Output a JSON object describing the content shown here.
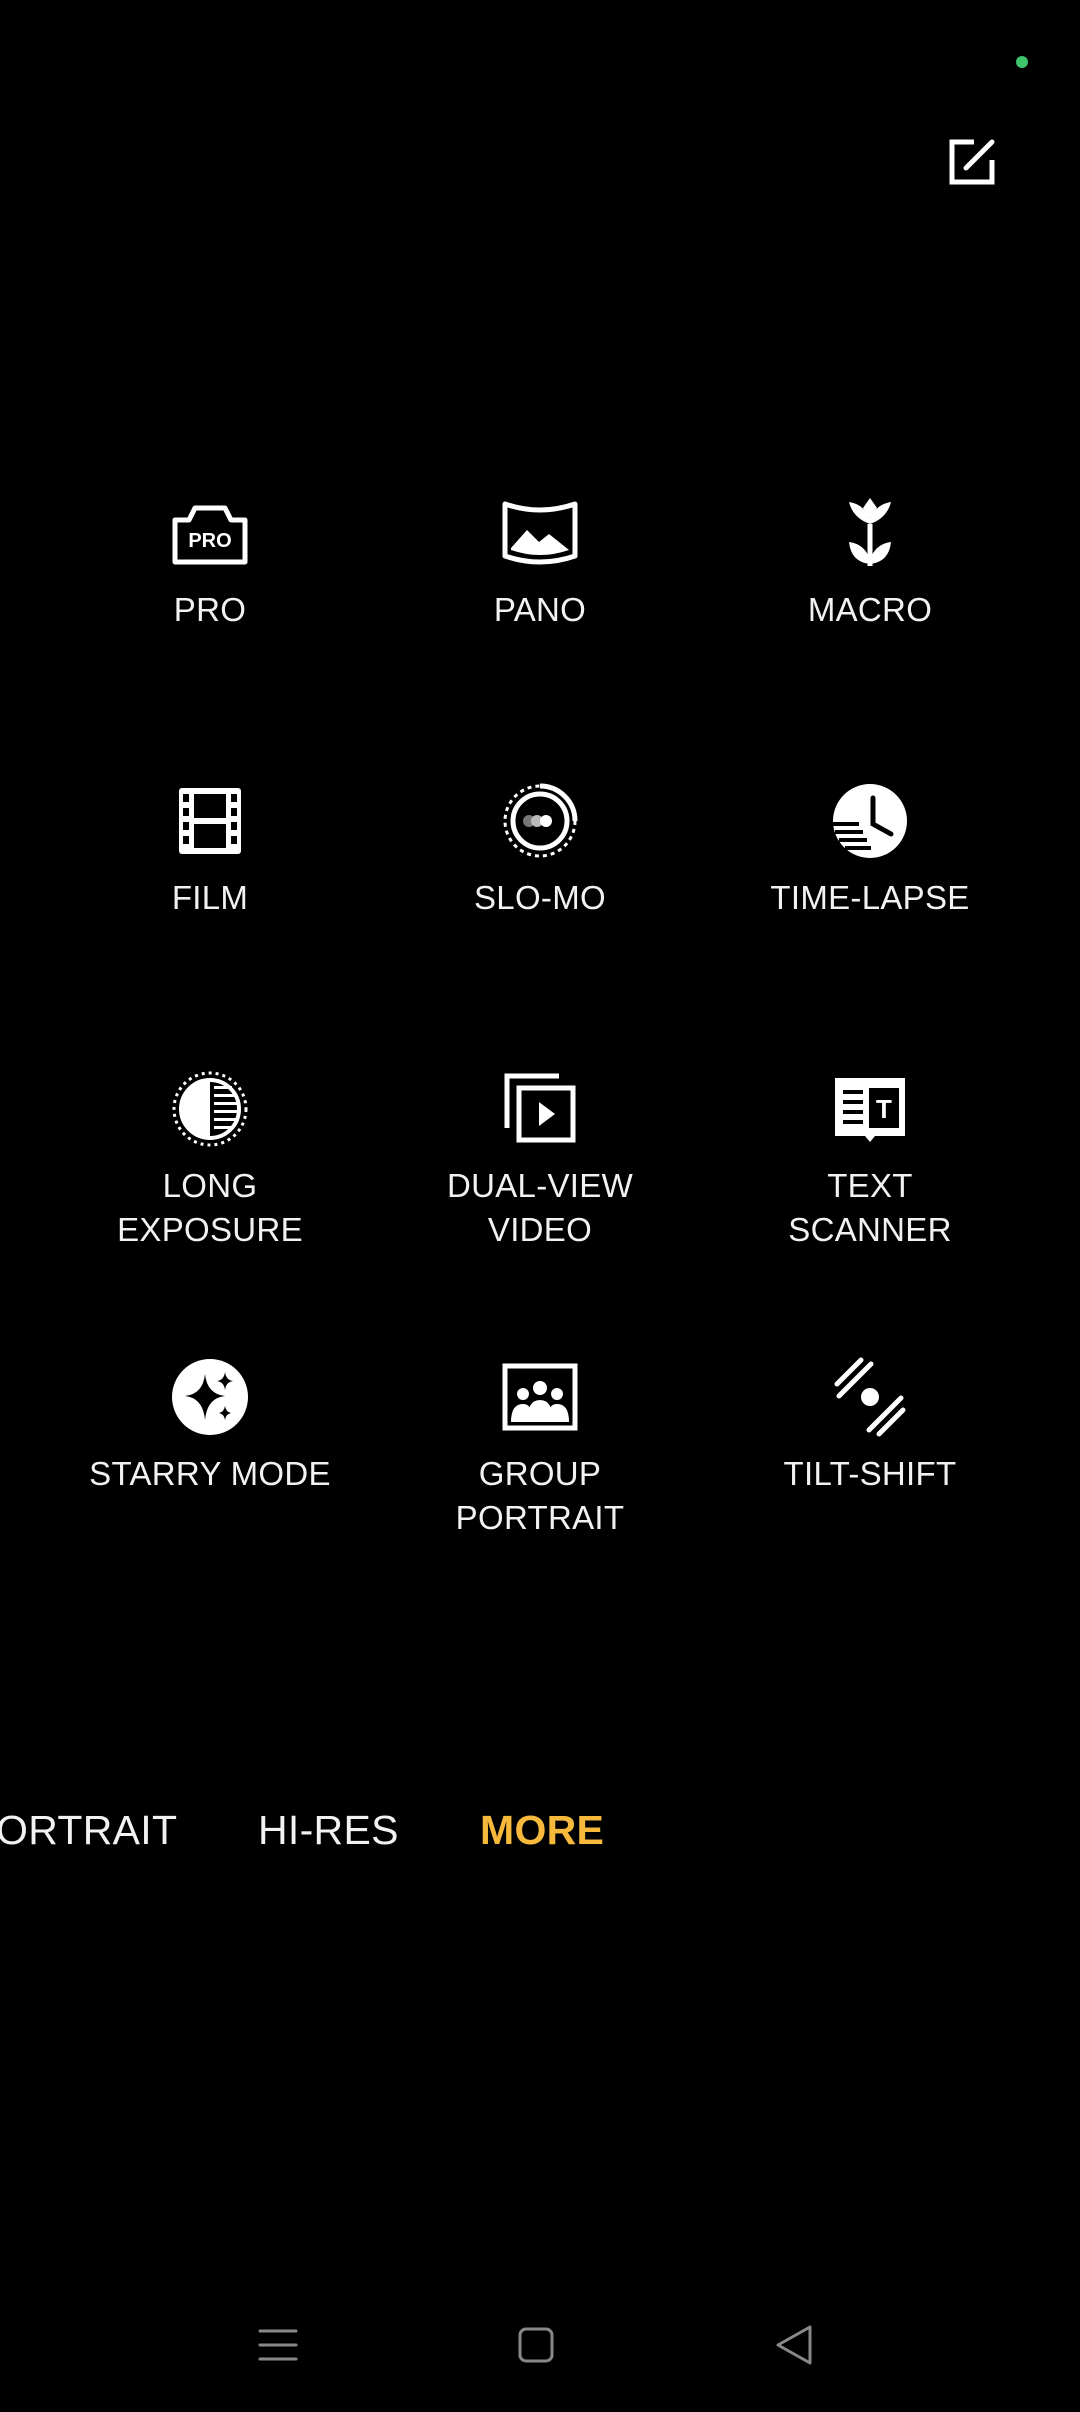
{
  "camera": {
    "edit_icon": "edit-icon",
    "modes": [
      {
        "id": "pro",
        "label": "PRO",
        "icon": "pro-camera-icon"
      },
      {
        "id": "pano",
        "label": "PANO",
        "icon": "panorama-icon"
      },
      {
        "id": "macro",
        "label": "MACRO",
        "icon": "flower-icon"
      },
      {
        "id": "film",
        "label": "FILM",
        "icon": "film-strip-icon"
      },
      {
        "id": "slo-mo",
        "label": "SLO-MO",
        "icon": "slow-motion-icon"
      },
      {
        "id": "time-lapse",
        "label": "TIME-LAPSE",
        "icon": "clock-speed-icon"
      },
      {
        "id": "long-exposure",
        "label": "LONG\nEXPOSURE",
        "icon": "long-exposure-icon"
      },
      {
        "id": "dual-view-video",
        "label": "DUAL-VIEW\nVIDEO",
        "icon": "dual-video-icon"
      },
      {
        "id": "text-scanner",
        "label": "TEXT\nSCANNER",
        "icon": "text-scanner-icon"
      },
      {
        "id": "starry-mode",
        "label": "STARRY MODE",
        "icon": "sparkle-icon"
      },
      {
        "id": "group-portrait",
        "label": "GROUP\nPORTRAIT",
        "icon": "group-icon"
      },
      {
        "id": "tilt-shift",
        "label": "TILT-SHIFT",
        "icon": "tilt-shift-icon"
      }
    ],
    "mode_bar": {
      "tabs": [
        "ORTRAIT",
        "HI-RES",
        "MORE"
      ],
      "active": "MORE"
    },
    "accent_color": "#f6b93b",
    "status_dot_color": "#3ec46d"
  },
  "nav": {
    "menu_icon": "menu-icon",
    "home_icon": "home-icon",
    "back_icon": "back-icon"
  }
}
